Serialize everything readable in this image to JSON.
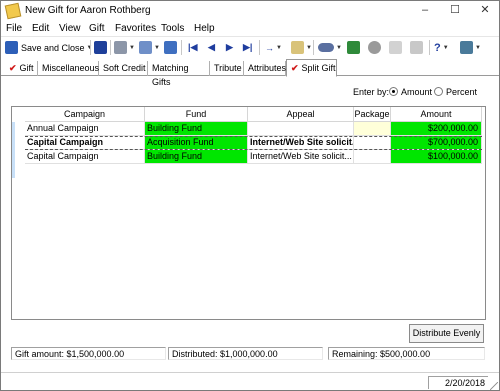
{
  "window": {
    "title": "New Gift for Aaron Rothberg",
    "min": "–",
    "max": "☐",
    "close": "✕"
  },
  "menu": [
    "File",
    "Edit",
    "View",
    "Gift",
    "Favorites",
    "Tools",
    "Help"
  ],
  "toolbar": {
    "save_close_label": "Save and Close",
    "help_glyph": "?"
  },
  "tabs": [
    "Gift",
    "Miscellaneous",
    "Soft Credit",
    "Matching Gifts",
    "Tribute",
    "Attributes",
    "Split Gift"
  ],
  "enter_by": {
    "label": "Enter by:",
    "amount": "Amount",
    "percent": "Percent",
    "selected": "Amount"
  },
  "grid": {
    "headers": [
      "Campaign",
      "Fund",
      "Appeal",
      "Package",
      "Amount"
    ],
    "rows": [
      {
        "campaign": "Annual Campaign",
        "fund": "Building Fund",
        "appeal": "",
        "package": "",
        "amount": "$200,000.00"
      },
      {
        "campaign": "Capital Campaign",
        "fund": "Acquisition Fund",
        "appeal": "Internet/Web Site solicit...",
        "package": "",
        "amount": "$700,000.00"
      },
      {
        "campaign": "Capital Campaign",
        "fund": "Building Fund",
        "appeal": "Internet/Web Site solicit...",
        "package": "",
        "amount": "$100,000.00"
      }
    ]
  },
  "distribute_label": "Distribute Evenly",
  "summary": {
    "gift_amount": "Gift amount:  $1,500,000.00",
    "distributed": "Distributed:  $1,000,000.00",
    "remaining": "Remaining:  $500,000.00"
  },
  "status": {
    "date": "2/20/2018"
  },
  "colors": {
    "fund_highlight": "#00e600",
    "package_highlight": "#ffffd9",
    "tab_check": "#d01a1a"
  }
}
